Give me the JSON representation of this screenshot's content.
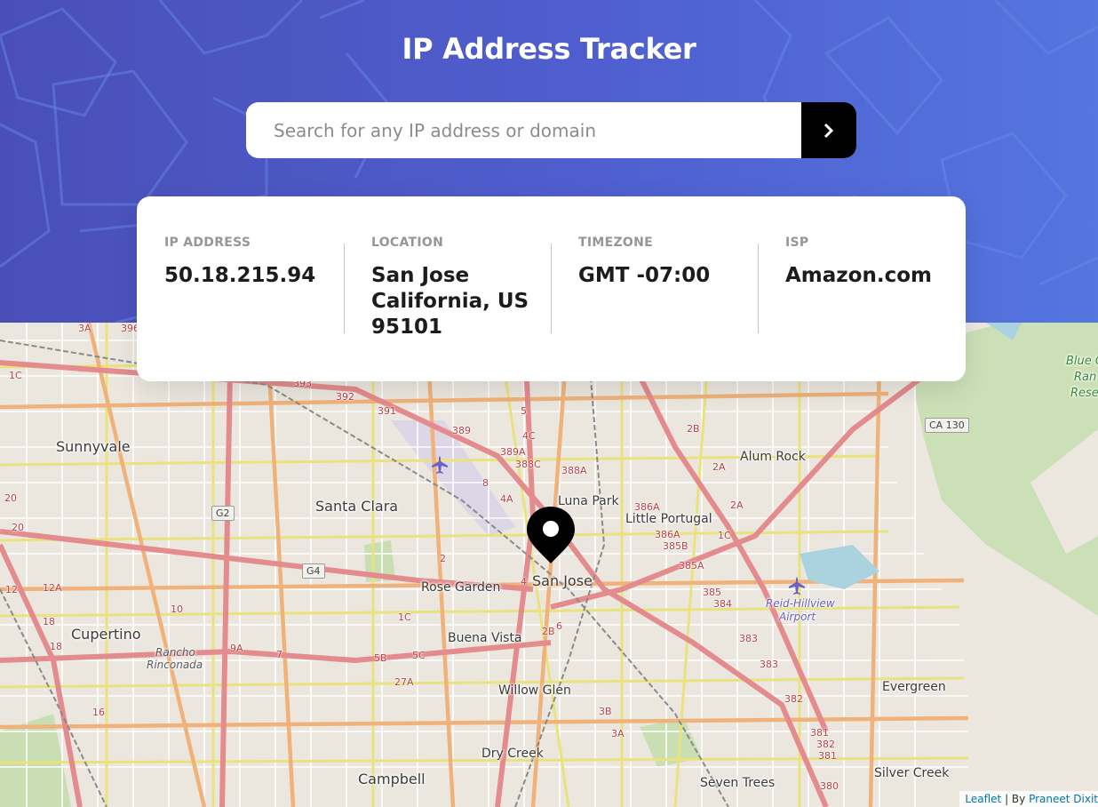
{
  "app": {
    "title": "IP Address Tracker"
  },
  "search": {
    "placeholder": "Search for any IP address or domain",
    "value": ""
  },
  "info": {
    "ip": {
      "label": "IP ADDRESS",
      "value": "50.18.215.94"
    },
    "location": {
      "label": "LOCATION",
      "value": "San Jose California, US 95101"
    },
    "timezone": {
      "label": "TIMEZONE",
      "value": "GMT -07:00"
    },
    "isp": {
      "label": "ISP",
      "value": "Amazon.com"
    }
  },
  "map": {
    "places": {
      "sunnyvale": "Sunnyvale",
      "santa_clara": "Santa Clara",
      "san_jose": "San Jose",
      "cupertino": "Cupertino",
      "rose_garden": "Rose Garden",
      "buena_vista": "Buena Vista",
      "willow_glen": "Willow Glen",
      "dry_creek": "Dry Creek",
      "campbell": "Campbell",
      "seven_trees": "Seven Trees",
      "silver_creek": "Silver Creek",
      "evergreen": "Evergreen",
      "alum_rock": "Alum Rock",
      "little_portugal": "Little Portugal",
      "luna_park": "Luna Park",
      "rancho_1": "Rancho",
      "rancho_2": "Rinconada",
      "reid_1": "Reid-Hillview",
      "reid_2": "Airport",
      "blue_1": "Blue O",
      "blue_2": "Ran",
      "blue_3": "Rese"
    },
    "shields": {
      "ca130": "CA 130",
      "g2": "G2",
      "g4": "G4"
    },
    "route_numbers": [
      "392",
      "391",
      "389",
      "389A",
      "388C",
      "388A",
      "386A",
      "386A",
      "385B",
      "385A",
      "385",
      "384",
      "383",
      "383",
      "382",
      "381",
      "382",
      "381",
      "380",
      "3B",
      "3A",
      "5",
      "4C",
      "4A",
      "4",
      "6",
      "8",
      "2B",
      "2A",
      "2A",
      "2B",
      "1C",
      "1C",
      "5B",
      "5C",
      "27A",
      "9A",
      "7",
      "10",
      "18",
      "18",
      "16",
      "12",
      "12A",
      "20",
      "20",
      "1C",
      "2",
      "393",
      "3A",
      "396"
    ],
    "colors": {
      "major": "#e88a8c",
      "primary": "#f6c495",
      "secondary": "#f7f5a4",
      "minor": "#ffffff",
      "park": "#c8dfb2"
    }
  },
  "attribution": {
    "leaflet": "Leaflet",
    "separator": " | By ",
    "author": "Praneet Dixit"
  }
}
